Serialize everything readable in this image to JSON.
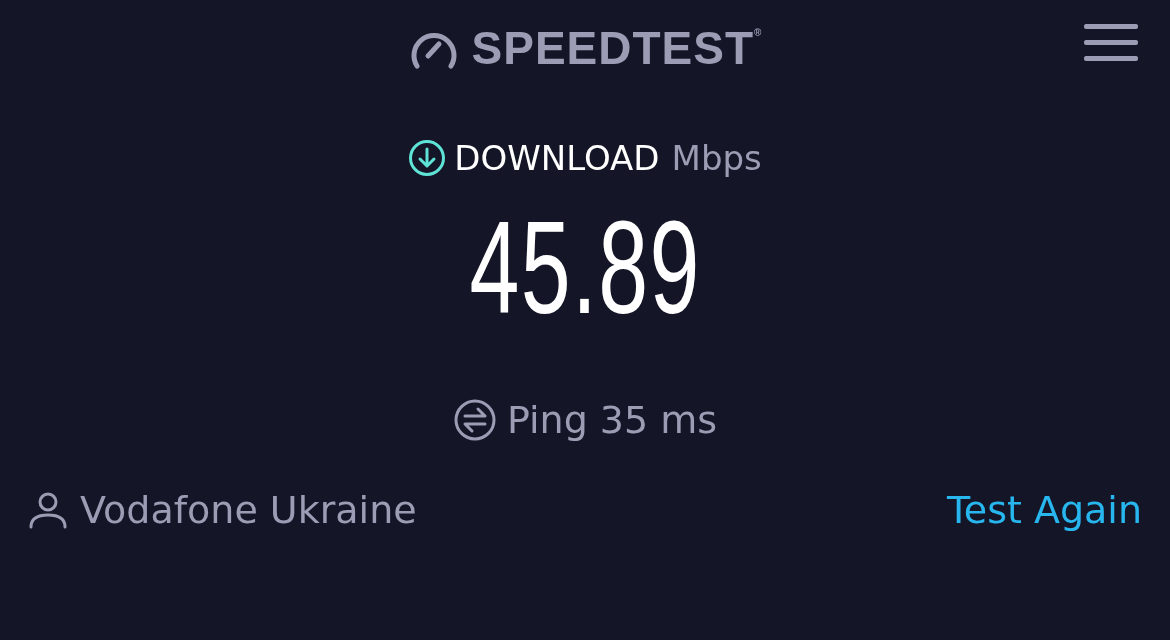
{
  "header": {
    "logo": "SPEEDTEST$^{®}$"
  },
  "result": {
    "label": "DOWNLOAD",
    "unit": "Mbps",
    "value": "45.89"
  },
  "ping": {
    "text": "Ping 35 ms"
  },
  "footer": {
    "provider": "Vodafone Ukraine",
    "action": "Test Again"
  }
}
